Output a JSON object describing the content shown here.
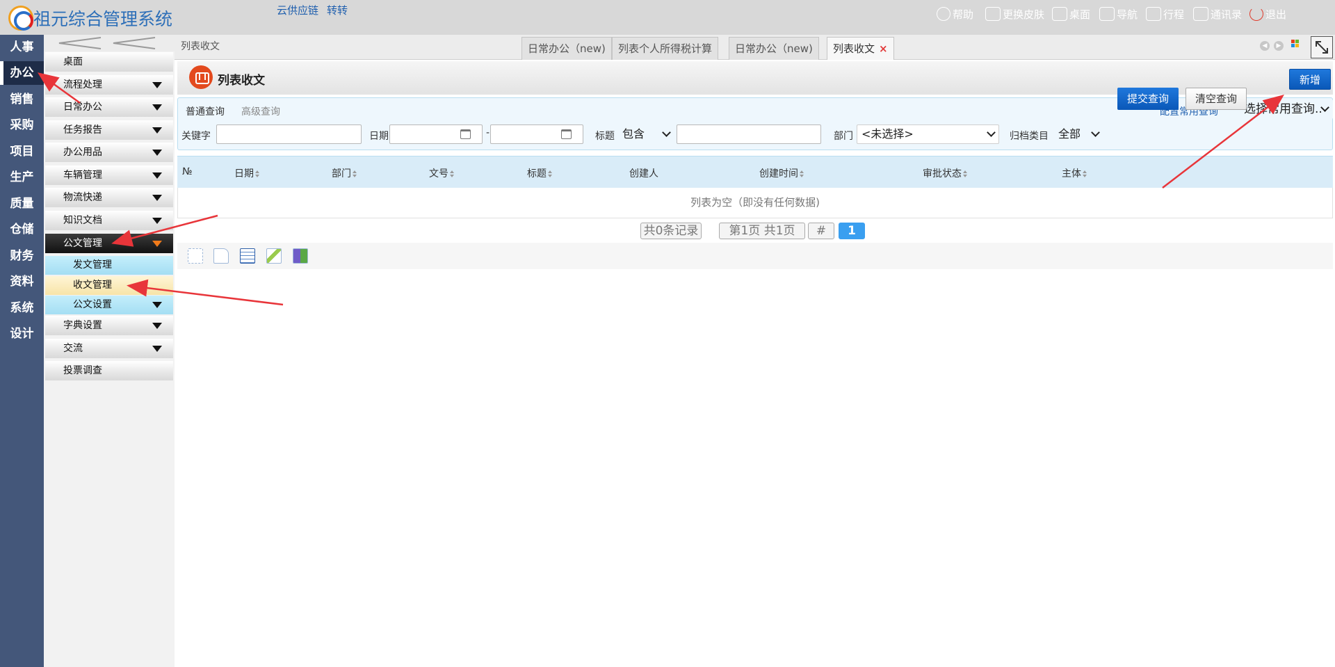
{
  "app": {
    "title": "祖元综合管理系统",
    "links": [
      "云供应链",
      "转转"
    ],
    "tools": [
      {
        "icon": "help-icon",
        "label": "帮助"
      },
      {
        "icon": "skin-icon",
        "label": "更换皮肤"
      },
      {
        "icon": "home-icon",
        "label": "桌面"
      },
      {
        "icon": "nav-icon",
        "label": "导航"
      },
      {
        "icon": "calendar-icon",
        "label": "行程"
      },
      {
        "icon": "contacts-icon",
        "label": "通讯录"
      },
      {
        "icon": "power-icon",
        "label": "退出"
      }
    ]
  },
  "leftnav": [
    "人事",
    "办公",
    "销售",
    "采购",
    "项目",
    "生产",
    "质量",
    "仓储",
    "财务",
    "资料",
    "系统",
    "设计"
  ],
  "leftnav_active": "办公",
  "sidemenu": {
    "items": [
      "桌面",
      "流程处理",
      "日常办公",
      "任务报告",
      "办公用品",
      "车辆管理",
      "物流快递",
      "知识文档",
      "公文管理"
    ],
    "sub": [
      "发文管理",
      "收文管理",
      "公文设置"
    ],
    "rest": [
      "字典设置",
      "交流",
      "投票调查"
    ]
  },
  "tabs": {
    "breadcrumb": "列表收文",
    "items": [
      "日常办公（new)",
      "列表个人所得税计算",
      "日常办公（new)",
      "列表收文"
    ],
    "active_index": 3
  },
  "page": {
    "title": "列表收文",
    "add_button": "新增"
  },
  "search": {
    "tab_normal": "普通查询",
    "tab_advanced": "高级查询",
    "config_link": "配置常用查询",
    "common_select": "选择常用查询..",
    "keyword_label": "关键字",
    "date_label": "日期",
    "date_sep": "-",
    "title_label": "标题",
    "title_op": "包含",
    "dept_label": "部门",
    "dept_value": "<未选择>",
    "archive_label": "归档类目",
    "archive_value": "全部",
    "submit": "提交查询",
    "clear": "清空查询"
  },
  "table": {
    "columns": [
      "№",
      "日期",
      "部门",
      "文号",
      "标题",
      "创建人",
      "创建时间",
      "审批状态",
      "主体"
    ],
    "empty_text": "列表为空（即没有任何数据)"
  },
  "pager": {
    "records": "共0条记录",
    "pages": "第1页 共1页",
    "hash": "#",
    "current": "1"
  },
  "colors": {
    "accent": "#0a58b8",
    "nav_bg": "#44577a",
    "arrow": "#e8353a"
  }
}
